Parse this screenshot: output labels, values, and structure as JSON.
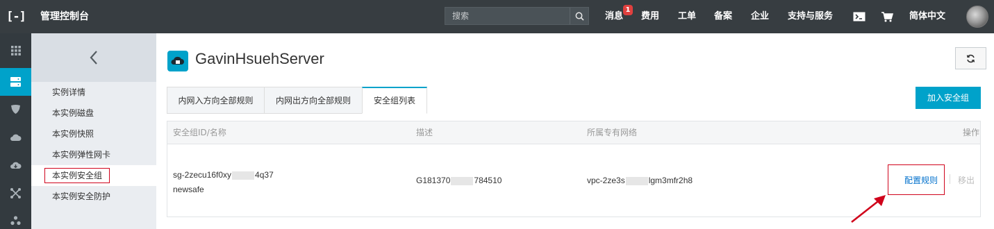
{
  "header": {
    "logo_text": "[-]",
    "app_title": "管理控制台",
    "search_placeholder": "搜索",
    "nav": [
      {
        "label": "消息"
      },
      {
        "label": "费用"
      },
      {
        "label": "工单"
      },
      {
        "label": "备案"
      },
      {
        "label": "企业"
      },
      {
        "label": "支持与服务"
      },
      {
        "label": "简体中文"
      }
    ],
    "message_badge": "1",
    "icons": [
      "terminal-icon",
      "cart-icon",
      "search-icon"
    ]
  },
  "rail": {
    "items": [
      "grid-icon",
      "server-icon",
      "shield-icon",
      "cloud-icon",
      "cloud-download-icon",
      "network-icon",
      "cluster-icon"
    ],
    "active_index": 1,
    "active_color": "#00a2ca"
  },
  "sidebar": {
    "back_icon": "chevron-left-icon",
    "items": [
      {
        "label": "实例详情"
      },
      {
        "label": "本实例磁盘"
      },
      {
        "label": "本实例快照"
      },
      {
        "label": "本实例弹性网卡"
      },
      {
        "label": "本实例安全组"
      },
      {
        "label": "本实例安全防护"
      }
    ],
    "active_index": 4
  },
  "main": {
    "title": "GavinHsuehServer",
    "tabs": [
      {
        "label": "内网入方向全部规则"
      },
      {
        "label": "内网出方向全部规则"
      },
      {
        "label": "安全组列表"
      }
    ],
    "active_tab": 2,
    "add_button": "加入安全组",
    "table": {
      "headers": {
        "id_name": "安全组ID/名称",
        "description": "描述",
        "vpc": "所属专有网络",
        "actions": "操作"
      },
      "rows": [
        {
          "id_prefix": "sg-2zecu16f0xy",
          "id_suffix": "4q37",
          "name": "newsafe",
          "desc_prefix": "G181370",
          "desc_suffix": "784510",
          "vpc_prefix": "vpc-2ze3s",
          "vpc_suffix": "lgm3mfr2h8",
          "action_config": "配置规则",
          "action_remove": "移出"
        }
      ]
    }
  },
  "colors": {
    "topbar": "#373d41",
    "rail": "#333a3f",
    "accent": "#00a2ca",
    "highlight": "#d0021b",
    "link": "#0070cc"
  }
}
